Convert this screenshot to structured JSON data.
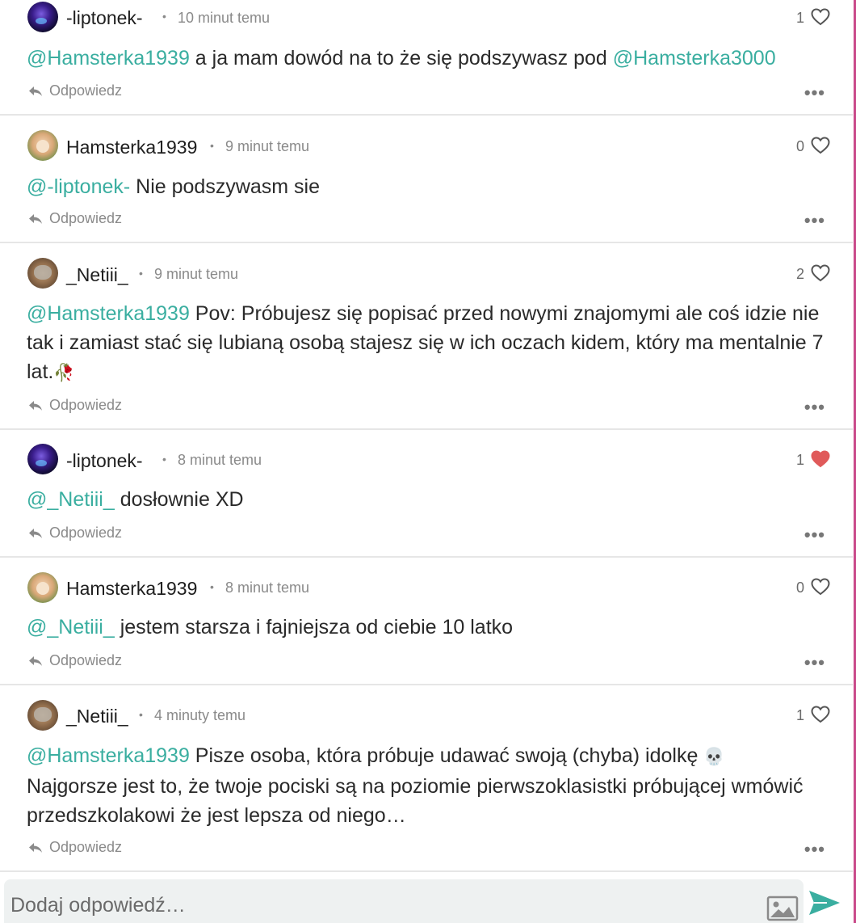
{
  "comments": [
    {
      "username": "-liptonek-",
      "avatar": "liptonek",
      "time": "10 minut temu",
      "likes": "1",
      "liked": false,
      "mention": "@Hamsterka1939",
      "text": " a ja mam dowód na to że się podszywasz pod ",
      "mention2": "@Hamsterka3000",
      "reply_label": "Odpowiedz"
    },
    {
      "username": "Hamsterka1939",
      "avatar": "hamster",
      "time": "9 minut temu",
      "likes": "0",
      "liked": false,
      "mention": "@-liptonek-",
      "text": " Nie podszywasm sie",
      "reply_label": "Odpowiedz"
    },
    {
      "username": "_Netiii_",
      "avatar": "netiii",
      "time": "9 minut temu",
      "likes": "2",
      "liked": false,
      "mention": "@Hamsterka1939",
      "text": " Pov: Próbujesz się popisać przed nowymi znajomymi ale coś idzie nie tak i zamiast stać się lubianą osobą stajesz się w ich oczach kidem, który ma mentalnie 7 lat.",
      "emoji": "🥀",
      "reply_label": "Odpowiedz"
    },
    {
      "username": "-liptonek-",
      "avatar": "liptonek",
      "time": "8 minut temu",
      "likes": "1",
      "liked": true,
      "mention": "@_Netiii_",
      "text": " dosłownie XD",
      "reply_label": "Odpowiedz"
    },
    {
      "username": "Hamsterka1939",
      "avatar": "hamster",
      "time": "8 minut temu",
      "likes": "0",
      "liked": false,
      "mention": "@_Netiii_",
      "text": " jestem starsza i fajniejsza od ciebie 10 latko",
      "reply_label": "Odpowiedz"
    },
    {
      "username": "_Netiii_",
      "avatar": "netiii",
      "time": "4 minuty temu",
      "likes": "1",
      "liked": false,
      "mention": "@Hamsterka1939",
      "text": " Pisze osoba, która próbuje udawać swoją (chyba) idolkę ",
      "emoji": "💀",
      "text2": "Najgorsze jest to, że twoje pociski są na poziomie pierwszoklasistki próbującej wmówić przedszkolakowi że jest lepsza od niego…",
      "reply_label": "Odpowiedz"
    }
  ],
  "composer": {
    "placeholder": "Dodaj odpowiedź…"
  },
  "colors": {
    "mention": "#3aaea0",
    "heart_liked": "#e05a5a",
    "send": "#3aaea0"
  }
}
